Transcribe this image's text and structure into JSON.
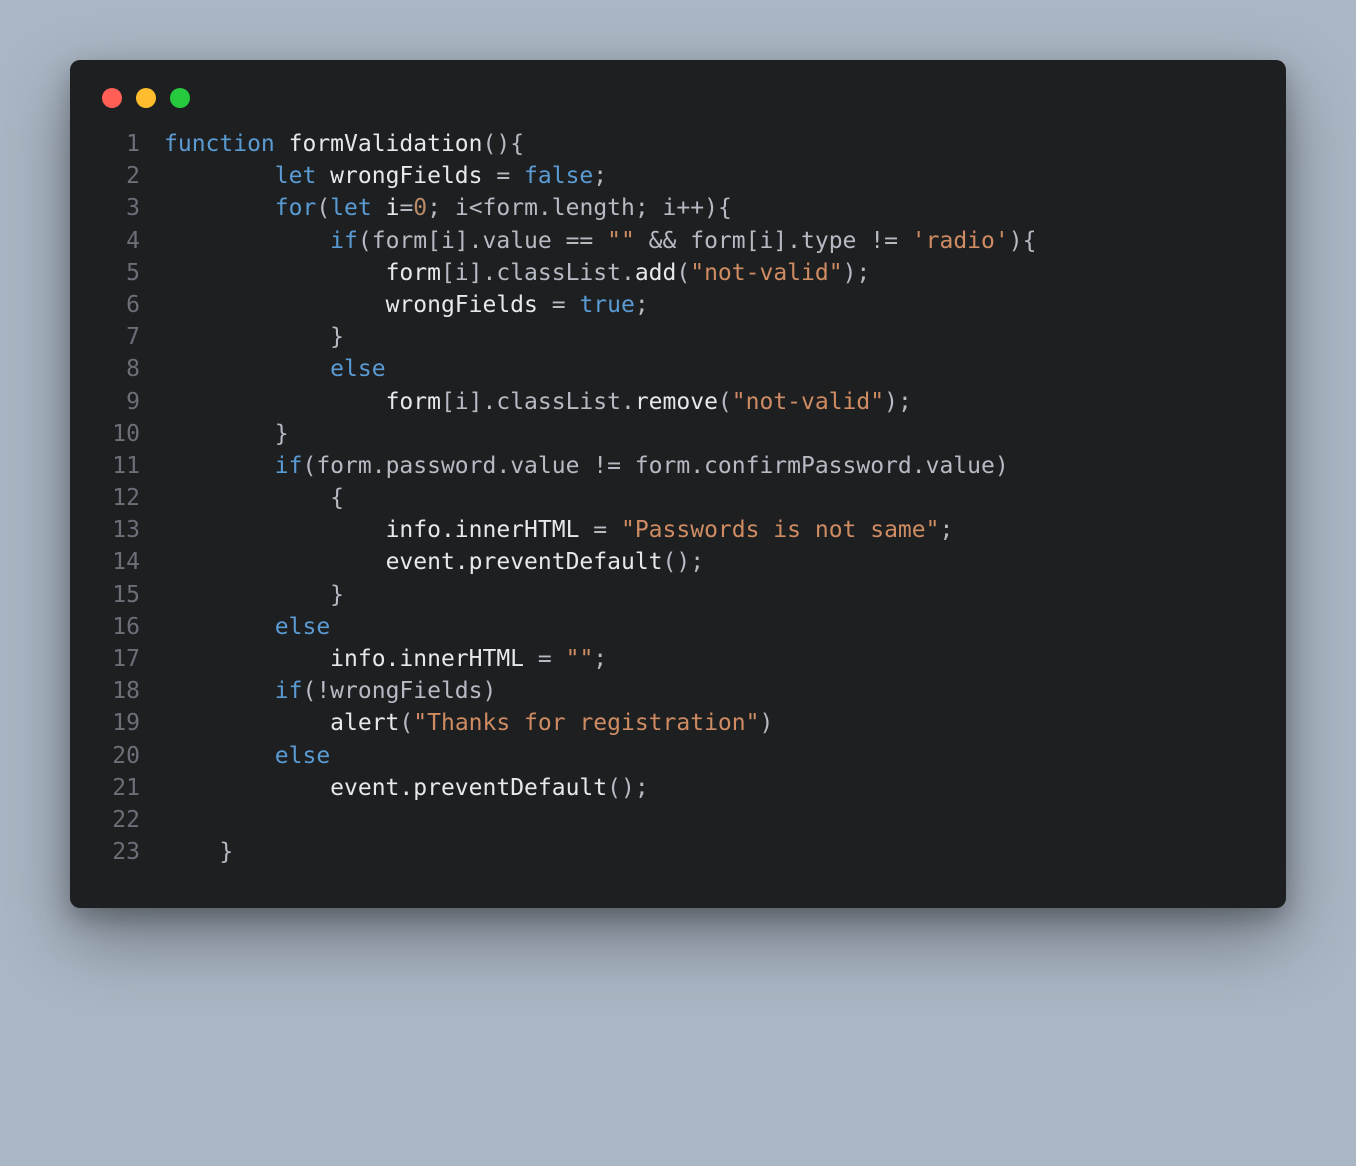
{
  "window": {
    "traffic_lights": [
      "red",
      "yellow",
      "green"
    ]
  },
  "code": {
    "lines": [
      {
        "n": 1,
        "tokens": [
          [
            "kw",
            "function"
          ],
          [
            "",
            ""
          ],
          [
            "fn",
            " formValidation"
          ],
          [
            "op",
            "(){"
          ]
        ]
      },
      {
        "n": 2,
        "tokens": [
          [
            "",
            "        "
          ],
          [
            "kw",
            "let"
          ],
          [
            "fn",
            " wrongFields "
          ],
          [
            "op",
            "= "
          ],
          [
            "kw",
            "false"
          ],
          [
            "op",
            ";"
          ]
        ]
      },
      {
        "n": 3,
        "tokens": [
          [
            "",
            "        "
          ],
          [
            "kw",
            "for"
          ],
          [
            "op",
            "("
          ],
          [
            "kw",
            "let"
          ],
          [
            "fn",
            " i"
          ],
          [
            "op",
            "="
          ],
          [
            "num",
            "0"
          ],
          [
            "op",
            "; i<form.length; i++){"
          ]
        ]
      },
      {
        "n": 4,
        "tokens": [
          [
            "",
            "            "
          ],
          [
            "kw",
            "if"
          ],
          [
            "op",
            "(form[i].value == "
          ],
          [
            "str",
            "\"\""
          ],
          [
            "op",
            " && form[i].type != "
          ],
          [
            "str",
            "'radio'"
          ],
          [
            "op",
            "){"
          ]
        ]
      },
      {
        "n": 5,
        "tokens": [
          [
            "",
            "                "
          ],
          [
            "fn",
            "form"
          ],
          [
            "op",
            "[i].classList."
          ],
          [
            "fn",
            "add"
          ],
          [
            "op",
            "("
          ],
          [
            "str",
            "\"not-valid\""
          ],
          [
            "op",
            ");"
          ]
        ]
      },
      {
        "n": 6,
        "tokens": [
          [
            "",
            "                "
          ],
          [
            "fn",
            "wrongFields "
          ],
          [
            "op",
            "= "
          ],
          [
            "kw",
            "true"
          ],
          [
            "op",
            ";"
          ]
        ]
      },
      {
        "n": 7,
        "tokens": [
          [
            "",
            "            "
          ],
          [
            "op",
            "}"
          ]
        ]
      },
      {
        "n": 8,
        "tokens": [
          [
            "",
            "            "
          ],
          [
            "kw",
            "else"
          ]
        ]
      },
      {
        "n": 9,
        "tokens": [
          [
            "",
            "                "
          ],
          [
            "fn",
            "form"
          ],
          [
            "op",
            "[i].classList."
          ],
          [
            "fn",
            "remove"
          ],
          [
            "op",
            "("
          ],
          [
            "str",
            "\"not-valid\""
          ],
          [
            "op",
            ");"
          ]
        ]
      },
      {
        "n": 10,
        "tokens": [
          [
            "",
            "        "
          ],
          [
            "op",
            "}"
          ]
        ]
      },
      {
        "n": 11,
        "tokens": [
          [
            "",
            "        "
          ],
          [
            "kw",
            "if"
          ],
          [
            "op",
            "(form.password.value != form.confirmPassword.value)"
          ]
        ]
      },
      {
        "n": 12,
        "tokens": [
          [
            "",
            "            "
          ],
          [
            "op",
            "{"
          ]
        ]
      },
      {
        "n": 13,
        "tokens": [
          [
            "",
            "                "
          ],
          [
            "fn",
            "info.innerHTML "
          ],
          [
            "op",
            "= "
          ],
          [
            "str",
            "\"Passwords is not same\""
          ],
          [
            "op",
            ";"
          ]
        ]
      },
      {
        "n": 14,
        "tokens": [
          [
            "",
            "                "
          ],
          [
            "fn",
            "event."
          ],
          [
            "fn",
            "preventDefault"
          ],
          [
            "op",
            "();"
          ]
        ]
      },
      {
        "n": 15,
        "tokens": [
          [
            "",
            "            "
          ],
          [
            "op",
            "}"
          ]
        ]
      },
      {
        "n": 16,
        "tokens": [
          [
            "",
            "        "
          ],
          [
            "kw",
            "else"
          ]
        ]
      },
      {
        "n": 17,
        "tokens": [
          [
            "",
            "            "
          ],
          [
            "fn",
            "info.innerHTML "
          ],
          [
            "op",
            "= "
          ],
          [
            "str",
            "\"\""
          ],
          [
            "op",
            ";"
          ]
        ]
      },
      {
        "n": 18,
        "tokens": [
          [
            "",
            "        "
          ],
          [
            "kw",
            "if"
          ],
          [
            "op",
            "(!wrongFields)"
          ]
        ]
      },
      {
        "n": 19,
        "tokens": [
          [
            "",
            "            "
          ],
          [
            "fn",
            "alert"
          ],
          [
            "op",
            "("
          ],
          [
            "str",
            "\"Thanks for registration\""
          ],
          [
            "op",
            ")"
          ]
        ]
      },
      {
        "n": 20,
        "tokens": [
          [
            "",
            "        "
          ],
          [
            "kw",
            "else"
          ]
        ]
      },
      {
        "n": 21,
        "tokens": [
          [
            "",
            "            "
          ],
          [
            "fn",
            "event."
          ],
          [
            "fn",
            "preventDefault"
          ],
          [
            "op",
            "();"
          ]
        ]
      },
      {
        "n": 22,
        "tokens": []
      },
      {
        "n": 23,
        "tokens": [
          [
            "",
            "    "
          ],
          [
            "op",
            "}"
          ]
        ]
      }
    ]
  }
}
